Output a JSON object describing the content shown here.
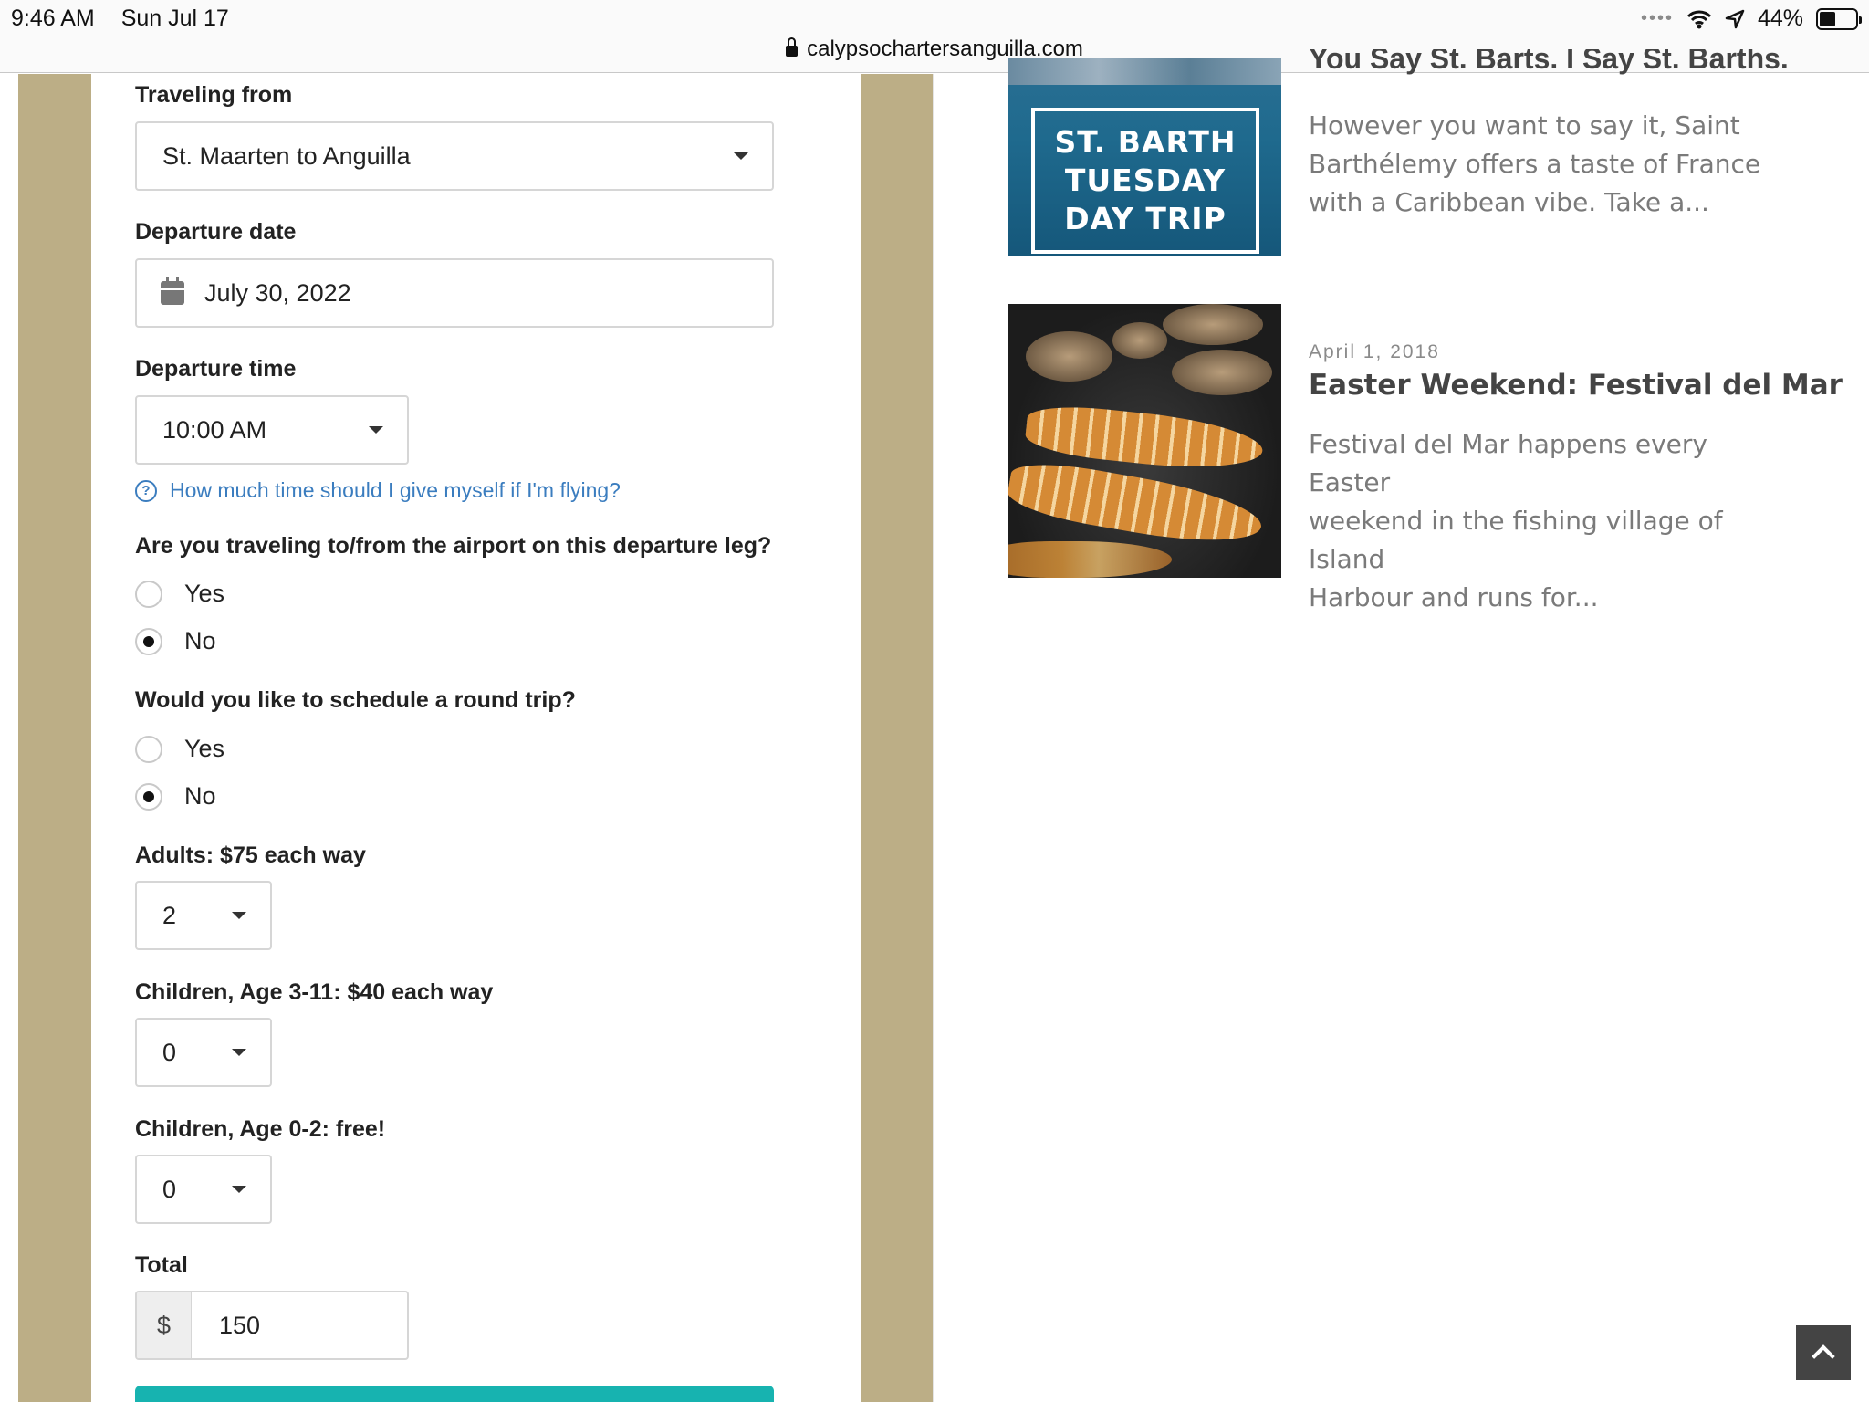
{
  "status_bar": {
    "time": "9:46 AM",
    "date": "Sun Jul 17",
    "battery": "44%",
    "battery_level": 0.44
  },
  "browser": {
    "url": "calypsochartersanguilla.com"
  },
  "form": {
    "traveling_from": {
      "label": "Traveling from",
      "value": "St. Maarten to Anguilla"
    },
    "departure_date": {
      "label": "Departure date",
      "value": "July 30, 2022"
    },
    "departure_time": {
      "label": "Departure time",
      "value": "10:00 AM"
    },
    "help_link": "How much time should I give myself if I'm flying?",
    "airport_question": {
      "label": "Are you traveling to/from the airport on this departure leg?",
      "options": [
        "Yes",
        "No"
      ],
      "selected": "No"
    },
    "round_trip_question": {
      "label": "Would you like to schedule a round trip?",
      "options": [
        "Yes",
        "No"
      ],
      "selected": "No"
    },
    "adults": {
      "label": "Adults: $75 each way",
      "value": "2"
    },
    "children_3_11": {
      "label": "Children, Age 3-11: $40 each way",
      "value": "0"
    },
    "children_0_2": {
      "label": "Children, Age 0-2: free!",
      "value": "0"
    },
    "total": {
      "label": "Total",
      "currency": "$",
      "value": "150"
    }
  },
  "posts": [
    {
      "title": "You Say St. Barts. I Say St. Barths.",
      "image_text": [
        "ST. BARTH",
        "TUESDAY",
        "DAY TRIP"
      ],
      "excerpt_lines": [
        "However you want to say it, Saint",
        "Barthélemy offers a taste of France",
        "with a Caribbean vibe. Take a..."
      ]
    },
    {
      "date": "April 1, 2018",
      "title": "Easter Weekend: Festival del Mar",
      "excerpt_lines": [
        "Festival del Mar happens every Easter",
        "weekend in the fishing village of Island",
        "Harbour and runs for..."
      ]
    }
  ],
  "colors": {
    "stripe": "#bcae86",
    "link": "#3b7dbf",
    "submit": "#17b3b0"
  }
}
